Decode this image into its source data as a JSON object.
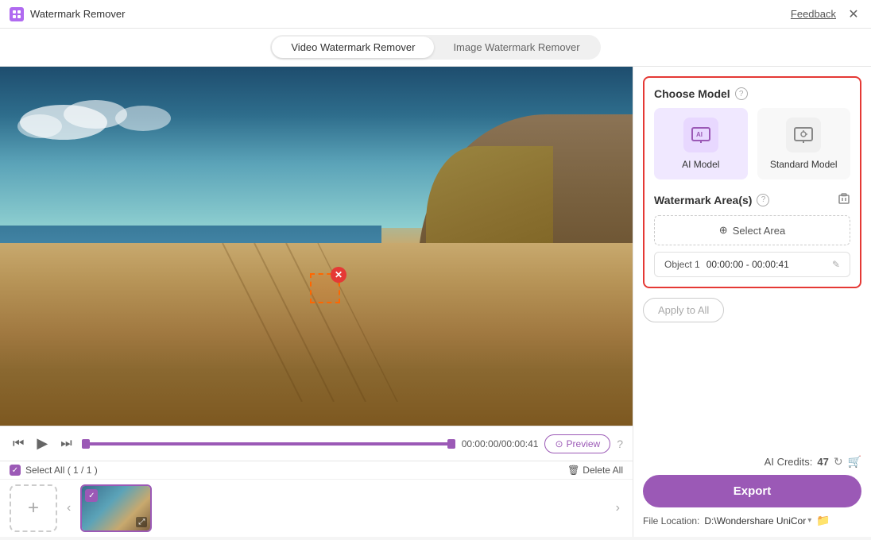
{
  "titleBar": {
    "title": "Watermark Remover",
    "feedback": "Feedback",
    "closeBtn": "✕"
  },
  "tabs": {
    "video": "Video Watermark Remover",
    "image": "Image Watermark Remover"
  },
  "rightPanel": {
    "chooseModel": "Choose Model",
    "aiModel": "AI Model",
    "standardModel": "Standard Model",
    "watermarkAreas": "Watermark Area(s)",
    "selectArea": "Select Area",
    "object1": "Object 1",
    "timeRange": "00:00:00 - 00:00:41",
    "applyToAll": "Apply to All",
    "aiCredits": "AI Credits:",
    "creditsNum": "47",
    "exportBtn": "Export",
    "fileLocation": "File Location:",
    "filePath": "D:\\Wondershare UniCor"
  },
  "videoControls": {
    "prevFrame": "⏮",
    "play": "▶",
    "nextFrame": "⏭",
    "timeDisplay": "00:00:00/00:00:41",
    "previewIcon": "⊙",
    "previewLabel": "Preview",
    "helpIcon": "?"
  },
  "fileStrip": {
    "selectAll": "Select All ( 1 / 1 )",
    "deleteAll": "Delete All"
  },
  "icons": {
    "aiModelIcon": "🎬",
    "standardModelIcon": "🎞",
    "crosshairIcon": "⊕",
    "trashIcon": "🗑",
    "pencilIcon": "✎",
    "refreshIcon": "↻",
    "cartIcon": "🛒",
    "folderIcon": "📁",
    "deleteIconLabel": "🗑"
  }
}
